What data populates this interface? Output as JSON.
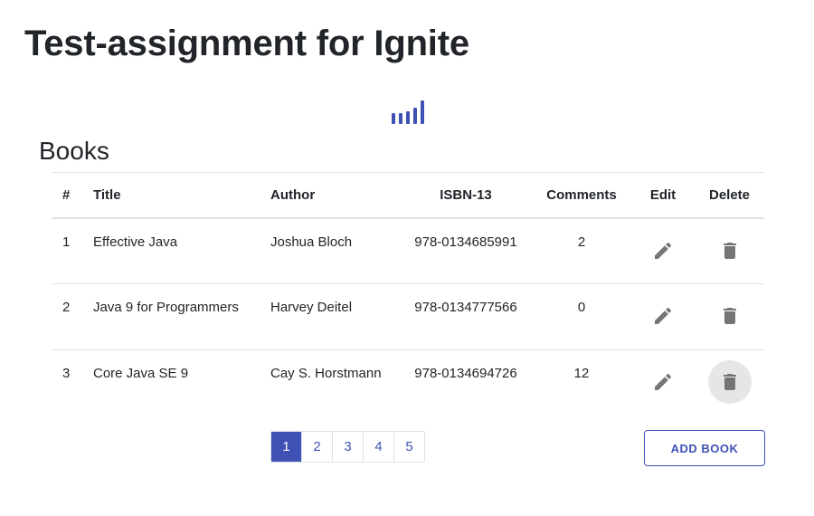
{
  "page": {
    "title": "Test-assignment for Ignite"
  },
  "section": {
    "title": "Books"
  },
  "table": {
    "columns": [
      "#",
      "Title",
      "Author",
      "ISBN-13",
      "Comments",
      "Edit",
      "Delete"
    ],
    "rows": [
      {
        "num": "1",
        "title": "Effective Java",
        "author": "Joshua Bloch",
        "isbn": "978-0134685991",
        "comments": "2"
      },
      {
        "num": "2",
        "title": "Java 9 for Programmers",
        "author": "Harvey Deitel",
        "isbn": "978-0134777566",
        "comments": "0"
      },
      {
        "num": "3",
        "title": "Core Java SE 9",
        "author": "Cay S. Horstmann",
        "isbn": "978-0134694726",
        "comments": "12"
      }
    ],
    "edit_icon": "pencil-icon",
    "delete_icon": "trash-icon"
  },
  "pagination": {
    "pages": [
      "1",
      "2",
      "3",
      "4",
      "5"
    ],
    "current": "1"
  },
  "actions": {
    "add_book_label": "ADD BOOK"
  },
  "colors": {
    "accent": "#3f51b5",
    "icon": "#757575",
    "border": "#dee2e6"
  }
}
